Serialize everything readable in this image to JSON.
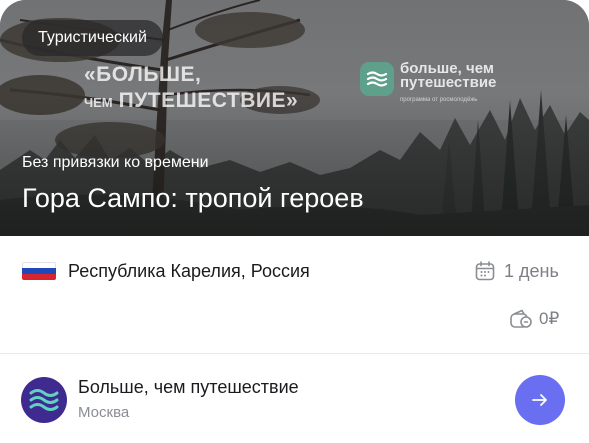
{
  "tour": {
    "badge": "Туристический",
    "promo_line1": "«БОЛЬШЕ,",
    "promo_line2_small": "ЧЕМ",
    "promo_line2": "ПУТЕШЕСТВИЕ»",
    "brand_name_line1": "больше, чем",
    "brand_name_line2": "путешествие",
    "brand_sub": "программа от росмолодёжь",
    "schedule": "Без привязки ко времени",
    "title": "Гора Сампо: тропой героев",
    "region": "Республика Карелия, Россия",
    "duration": "1 день",
    "price": "0₽"
  },
  "organizer": {
    "name": "Больше, чем путешествие",
    "city": "Москва"
  },
  "colors": {
    "accent": "#6a6ff2",
    "avatar_bg": "#3f2a8f",
    "brand_green": "#5fa08a",
    "muted_text": "#7c7f86",
    "flag_white": "#ffffff",
    "flag_blue": "#1f49b8",
    "flag_red": "#d7252f"
  },
  "icons": {
    "flag": "russia-flag-icon",
    "duration": "calendar-icon",
    "price": "wallet-coins-icon",
    "action": "arrow-right-icon",
    "organizer": "waves-logo-icon",
    "brand": "waves-logo-icon"
  }
}
